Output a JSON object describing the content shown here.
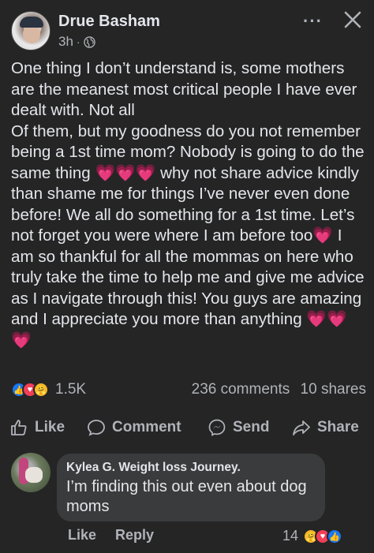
{
  "post": {
    "author": "Drue Basham",
    "time": "3h",
    "separator": "·",
    "more_label": "···",
    "text": "One thing I don’t understand is, some mothers are the meanest most critical people I have ever dealt with. Not all\nOf them, but my goodness do you not remember being a 1st time mom? Nobody is going to do the same thing 💗💗💗 why not share advice kindly than shame me for things I’ve never even done before! We all do something for a 1st time. Let’s not forget you were where I am before too💗 I am so thankful for all the mommas on here who truly take the time to help me and give me advice as I navigate through this! You guys are amazing and I appreciate you more than anything 💗💗💗",
    "reaction_count": "1.5K",
    "comments_count": "236 comments",
    "shares_count": "10 shares"
  },
  "actions": {
    "like": "Like",
    "comment": "Comment",
    "send": "Send",
    "share": "Share"
  },
  "comment": {
    "author": "Kylea G. Weight loss Journey.",
    "text": "I’m finding this out even about dog moms",
    "like": "Like",
    "reply": "Reply",
    "reaction_count": "14"
  },
  "colors": {
    "background": "#252526",
    "text": "#e4e6eb",
    "secondary": "#b0b3b8",
    "bubble": "#3a3b3c",
    "like_blue": "#1877f2",
    "love_red": "#f33e58"
  },
  "icons": [
    "globe-icon",
    "close-icon",
    "like-icon",
    "comment-icon",
    "messenger-icon",
    "share-icon",
    "like-reaction-icon",
    "love-reaction-icon",
    "care-reaction-icon"
  ]
}
